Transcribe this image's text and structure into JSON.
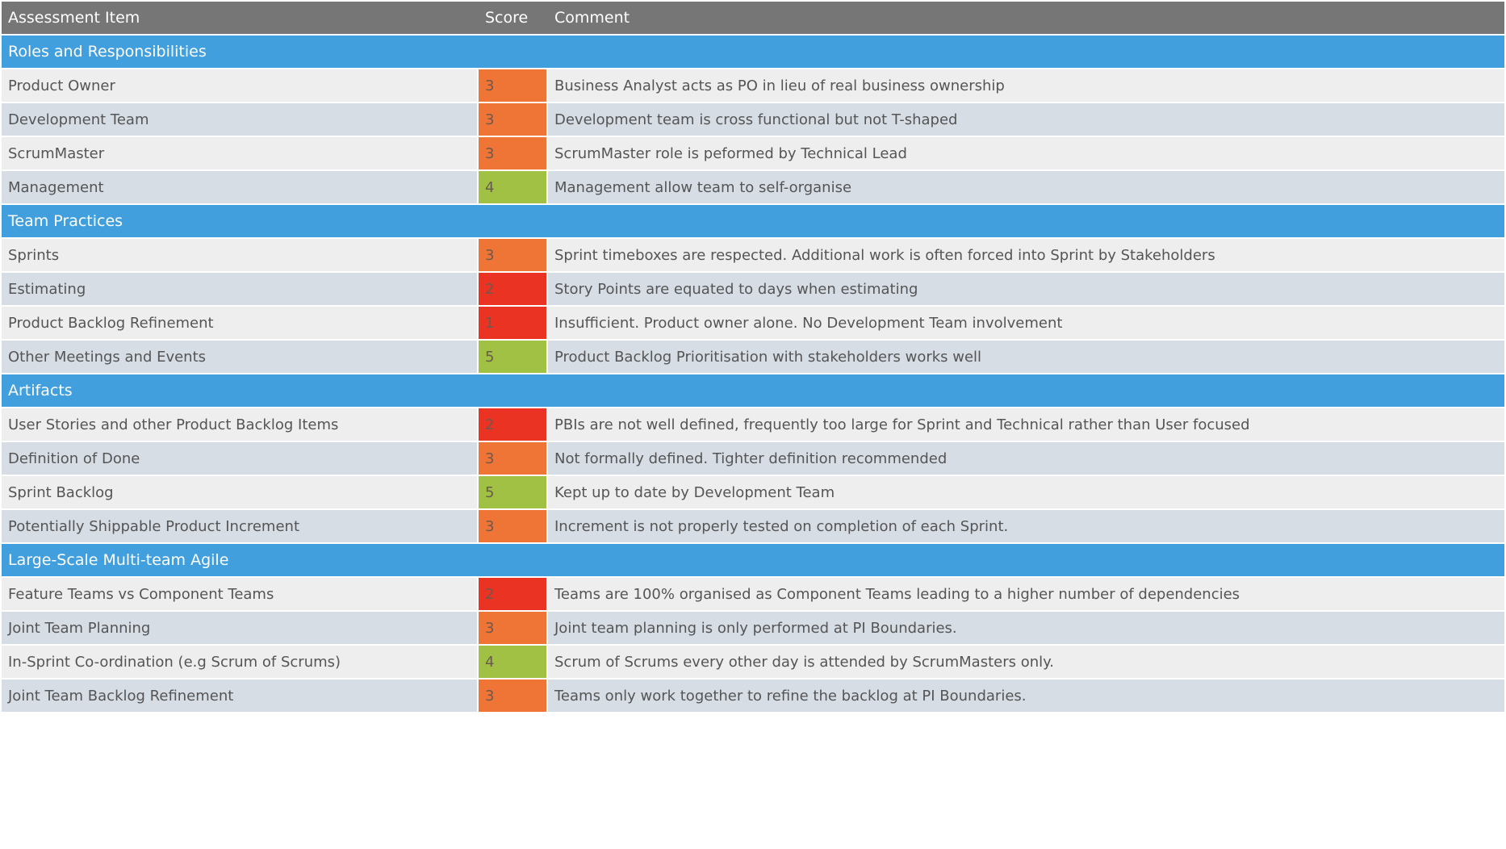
{
  "columns": {
    "item": "Assessment Item",
    "score": "Score",
    "comment": "Comment"
  },
  "score_colors": {
    "1": "#ea3323",
    "2": "#ea3323",
    "3": "#ef7536",
    "4": "#a0c143",
    "5": "#a0c143"
  },
  "sections": [
    {
      "title": "Roles and Responsibilities",
      "rows": [
        {
          "item": "Product Owner",
          "score": "3",
          "comment": "Business Analyst acts as PO in lieu of real business ownership"
        },
        {
          "item": "Development Team",
          "score": "3",
          "comment": "Development team is cross functional but not T-shaped"
        },
        {
          "item": "ScrumMaster",
          "score": "3",
          "comment": "ScrumMaster role is peformed by Technical Lead"
        },
        {
          "item": "Management",
          "score": "4",
          "comment": "Management allow team to self-organise"
        }
      ]
    },
    {
      "title": "Team Practices",
      "rows": [
        {
          "item": "Sprints",
          "score": "3",
          "comment": "Sprint timeboxes are respected. Additional work is often forced into Sprint by Stakeholders"
        },
        {
          "item": "Estimating",
          "score": "2",
          "comment": "Story Points are equated to days when estimating"
        },
        {
          "item": "Product Backlog Refinement",
          "score": "1",
          "comment": "Insufficient. Product owner alone. No Development Team involvement"
        },
        {
          "item": "Other Meetings and Events",
          "score": "5",
          "comment": "Product Backlog Prioritisation with stakeholders works well"
        }
      ]
    },
    {
      "title": "Artifacts",
      "rows": [
        {
          "item": "User Stories and other Product Backlog Items",
          "score": "2",
          "comment": "PBIs are not well defined, frequently too large for Sprint and Technical rather than User focused"
        },
        {
          "item": "Definition of Done",
          "score": "3",
          "comment": "Not formally defined. Tighter definition recommended"
        },
        {
          "item": "Sprint Backlog",
          "score": "5",
          "comment": "Kept up to date by Development Team"
        },
        {
          "item": "Potentially Shippable Product Increment",
          "score": "3",
          "comment": "Increment is not properly tested on completion of each Sprint."
        }
      ]
    },
    {
      "title": "Large-Scale Multi-team Agile",
      "rows": [
        {
          "item": "Feature Teams vs Component Teams",
          "score": "2",
          "comment": "Teams are 100% organised as Component Teams leading to a higher number of dependencies"
        },
        {
          "item": "Joint Team Planning",
          "score": "3",
          "comment": "Joint team planning is only performed at PI Boundaries."
        },
        {
          "item": "In-Sprint Co-ordination (e.g Scrum of Scrums)",
          "score": "4",
          "comment": "Scrum of Scrums every other day is attended by ScrumMasters only."
        },
        {
          "item": "Joint Team Backlog Refinement",
          "score": "3",
          "comment": "Teams only work together to refine the backlog at PI Boundaries."
        }
      ]
    }
  ]
}
